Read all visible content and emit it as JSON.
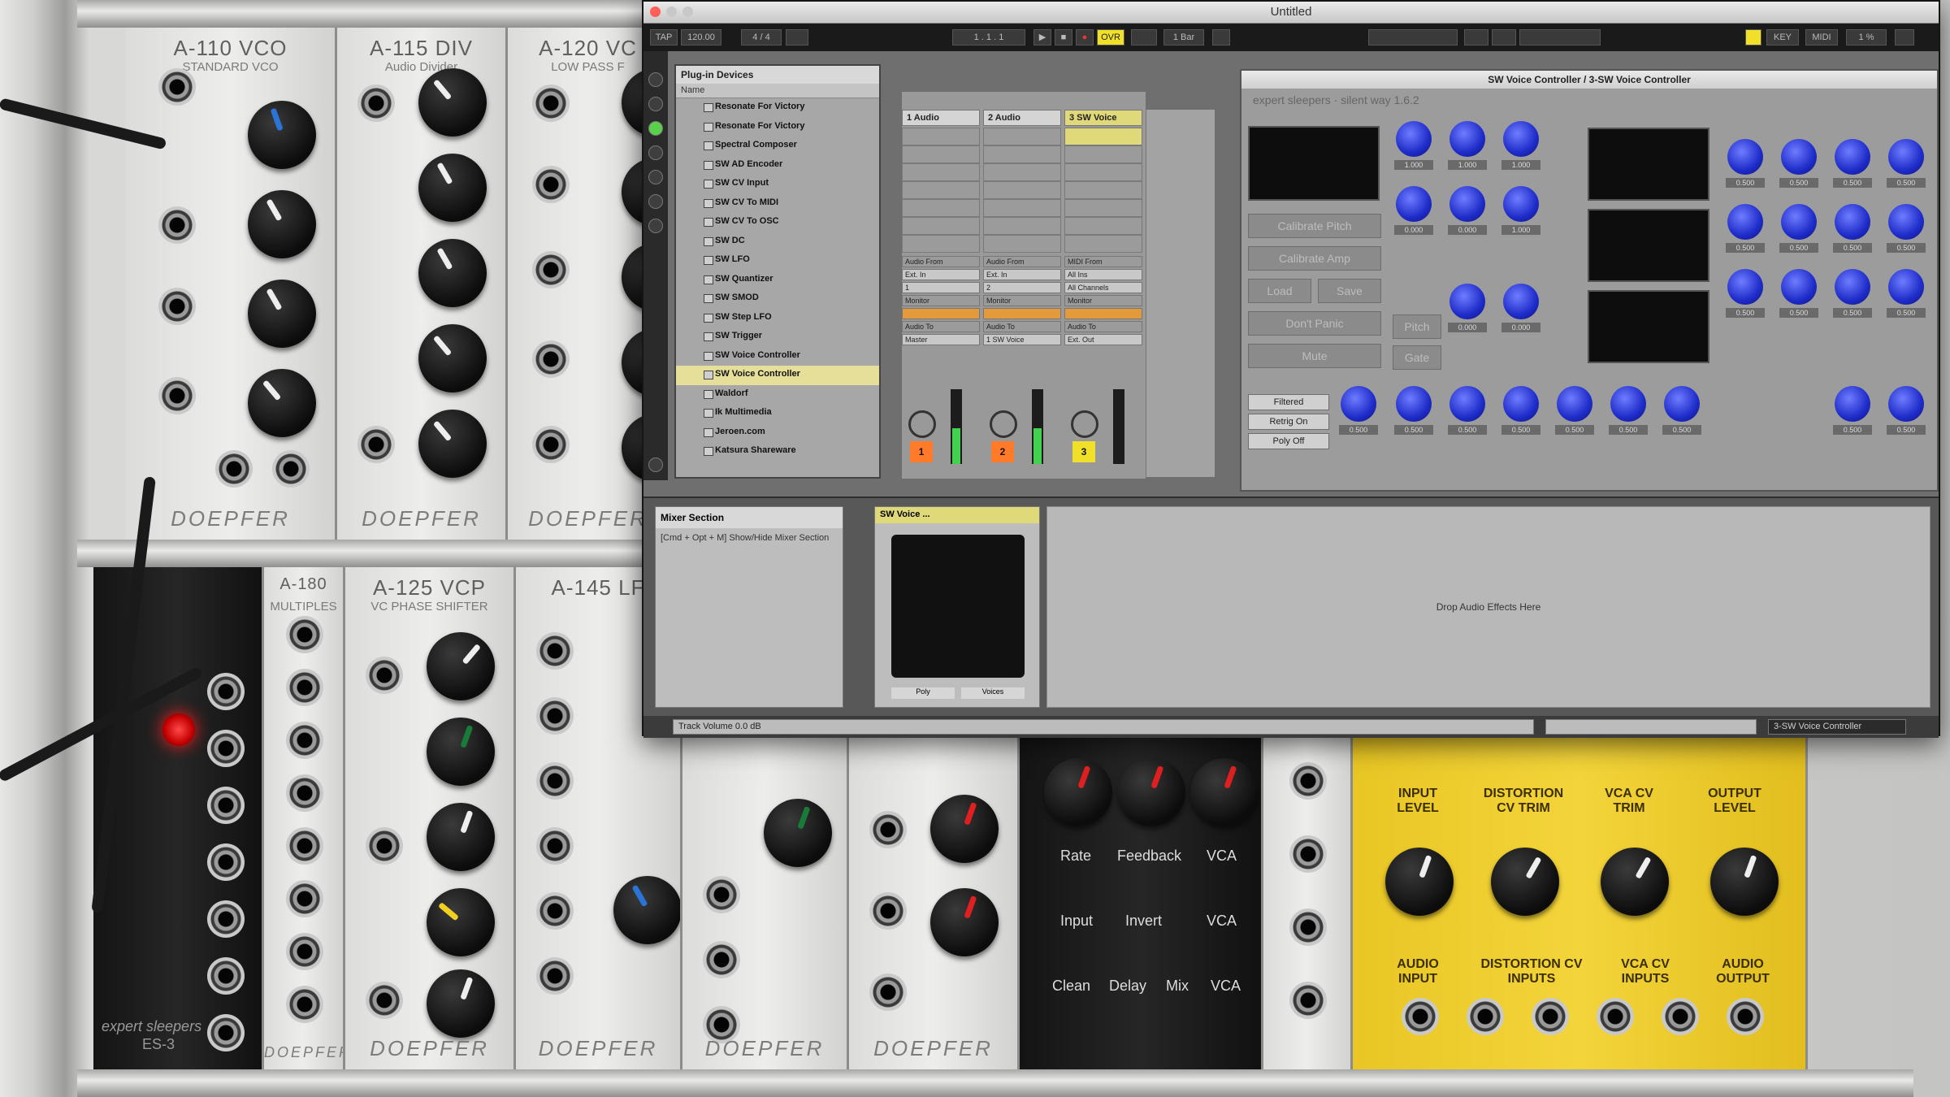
{
  "rack": {
    "modules_top": [
      {
        "title": "A-110 VCO",
        "subtitle": "STANDARD VCO",
        "brand": "DOEPFER"
      },
      {
        "title": "A-115 DIV",
        "subtitle": "Audio Divider",
        "brand": "DOEPFER"
      },
      {
        "title": "A-120 VC",
        "subtitle": "LOW PASS F",
        "brand": "DOEPFER"
      }
    ],
    "modules_bottom": [
      {
        "title": "A-180",
        "subtitle": "MULTIPLES",
        "brand": "DOEPFER"
      },
      {
        "title": "A-125 VCP",
        "subtitle": "VC PHASE SHIFTER",
        "brand": "DOEPFER"
      },
      {
        "title": "A-145 LF",
        "subtitle": "",
        "brand": "DOEPFER"
      },
      {
        "title": "",
        "subtitle": "",
        "brand": "DOEPFER"
      },
      {
        "title": "",
        "subtitle": "",
        "brand": "DOEPFER"
      }
    ],
    "left_module_brand": "expert sleepers",
    "left_module_name": "ES-3",
    "fx_labels": [
      "Rate",
      "Feedback",
      "VCA",
      "Input",
      "Invert",
      "VCA",
      "Clean",
      "Delay",
      "Mix",
      "VCA"
    ],
    "yellow_labels": [
      "INPUT LEVEL",
      "DISTORTION CV TRIM",
      "VCA CV TRIM",
      "OUTPUT LEVEL",
      "AUDIO INPUT",
      "DISTORTION CV INPUTS",
      "VCA CV INPUTS",
      "AUDIO OUTPUT"
    ]
  },
  "window": {
    "title": "Untitled"
  },
  "controlbar": {
    "tap": "TAP",
    "tempo": "120.00",
    "sig": "4 / 4",
    "pos": "1 . 1 . 1",
    "ovr": "OVR",
    "loop_len": "1 Bar",
    "key": "KEY",
    "midi": "MIDI",
    "cpu": "1 %"
  },
  "browser": {
    "title": "Plug-in Devices",
    "column": "Name",
    "items": [
      {
        "label": "Resonate For Victory",
        "selected": false
      },
      {
        "label": "Resonate For Victory",
        "selected": false
      },
      {
        "label": "Spectral Composer",
        "selected": false
      },
      {
        "label": "SW AD Encoder",
        "selected": false
      },
      {
        "label": "SW CV Input",
        "selected": false
      },
      {
        "label": "SW CV To MIDI",
        "selected": false
      },
      {
        "label": "SW CV To OSC",
        "selected": false
      },
      {
        "label": "SW DC",
        "selected": false
      },
      {
        "label": "SW LFO",
        "selected": false
      },
      {
        "label": "SW Quantizer",
        "selected": false
      },
      {
        "label": "SW SMOD",
        "selected": false
      },
      {
        "label": "SW Step LFO",
        "selected": false
      },
      {
        "label": "SW Trigger",
        "selected": false
      },
      {
        "label": "SW Voice Controller",
        "selected": false
      },
      {
        "label": "SW Voice Controller",
        "selected": true
      },
      {
        "label": "Waldorf",
        "selected": false
      },
      {
        "label": "Ik Multimedia",
        "selected": false
      },
      {
        "label": "Jeroen.com",
        "selected": false
      },
      {
        "label": "Katsura Shareware",
        "selected": false
      }
    ]
  },
  "tracks": [
    {
      "name": "1 Audio",
      "num": "1",
      "color": "#ff7b2a",
      "io_from": "Audio From",
      "io_src": "Ext. In",
      "io_ch": "1",
      "monitor": "Monitor",
      "io_to": "Audio To",
      "io_dst": "Master"
    },
    {
      "name": "2 Audio",
      "num": "2",
      "color": "#ff7b2a",
      "io_from": "Audio From",
      "io_src": "Ext. In",
      "io_ch": "2",
      "monitor": "Monitor",
      "io_to": "Audio To",
      "io_dst": "1 SW Voice"
    },
    {
      "name": "3 SW Voice",
      "num": "3",
      "color": "#f0e02a",
      "io_from": "MIDI From",
      "io_src": "All Ins",
      "io_ch": "All Channels",
      "monitor": "Monitor",
      "io_to": "Audio To",
      "io_dst": "Ext. Out"
    }
  ],
  "plugin": {
    "title": "SW Voice Controller / 3-SW Voice Controller",
    "subtitle": "expert sleepers · silent way 1.6.2",
    "buttons": [
      "Calibrate Pitch",
      "Calibrate Amp",
      "Load",
      "Save",
      "Don't Panic",
      "Mute"
    ],
    "mode_buttons": [
      "Pitch",
      "Gate"
    ],
    "options": [
      "Filtered",
      "Retrig On",
      "Poly Off"
    ],
    "knob_value_a": "1.000",
    "knob_value_b": "0.000",
    "knob_value_c": "0.500"
  },
  "device_view": {
    "mixer_title": "Mixer Section",
    "mixer_hint": "[Cmd + Opt + M] Show/Hide Mixer Section",
    "device_name": "SW Voice ...",
    "device_btn1": "Poly",
    "device_btn2": "Voices",
    "drop_text": "Drop Audio Effects Here"
  },
  "status": {
    "left": "Track Volume 0.0 dB",
    "right": "3-SW Voice Controller"
  }
}
